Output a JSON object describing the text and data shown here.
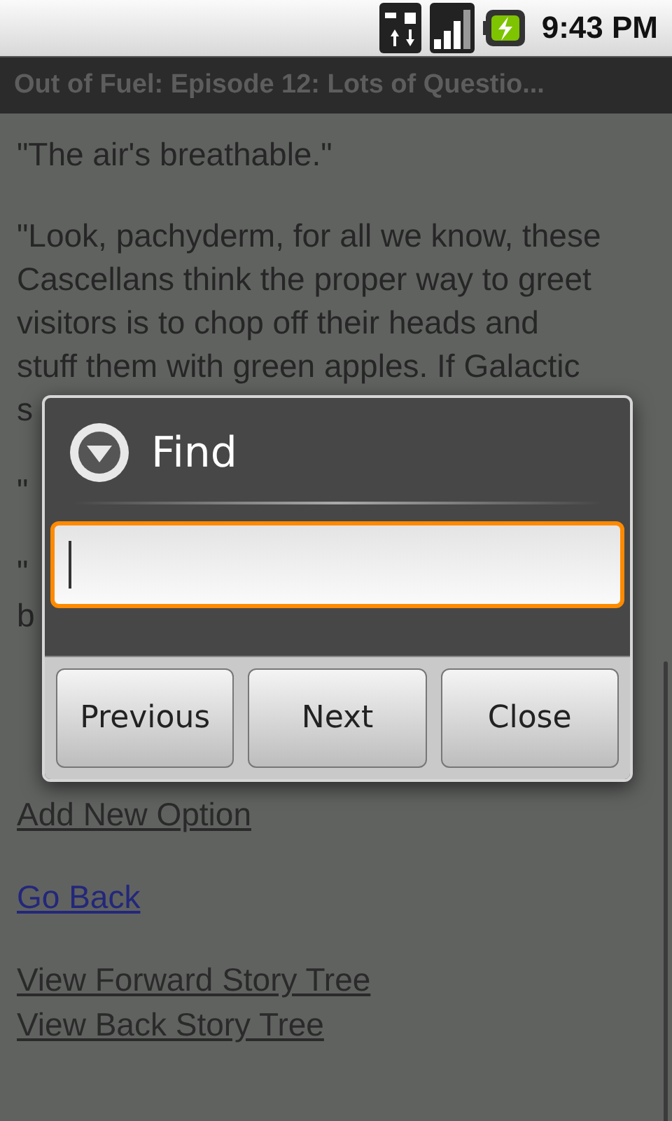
{
  "status_bar": {
    "time": "9:43 PM"
  },
  "title_bar": {
    "title": "Out of Fuel: Episode 12: Lots of Questio..."
  },
  "story": {
    "paragraphs": [
      {
        "lines": [
          "\"The air's breathable.\""
        ]
      },
      {
        "lines": [
          "\"Look, pachyderm, for all we know, these",
          "Cascellans think the proper way to greet",
          "visitors is to chop off their heads and",
          "stuff them with green apples. If Galactic",
          "s"
        ]
      },
      {
        "lines": [
          "\""
        ]
      },
      {
        "lines": [
          "\"",
          "b"
        ]
      }
    ]
  },
  "link_groups": [
    {
      "links": [
        {
          "label": "Add New Option",
          "visited": true
        }
      ]
    },
    {
      "links": [
        {
          "label": "Go Back",
          "visited": false
        }
      ]
    },
    {
      "links": [
        {
          "label": "View Forward Story Tree",
          "visited": true
        },
        {
          "label": "View Back Story Tree",
          "visited": true
        }
      ]
    }
  ],
  "find_dialog": {
    "title": "Find",
    "search": {
      "focused": true
    },
    "buttons": [
      "Previous",
      "Next",
      "Close"
    ]
  }
}
